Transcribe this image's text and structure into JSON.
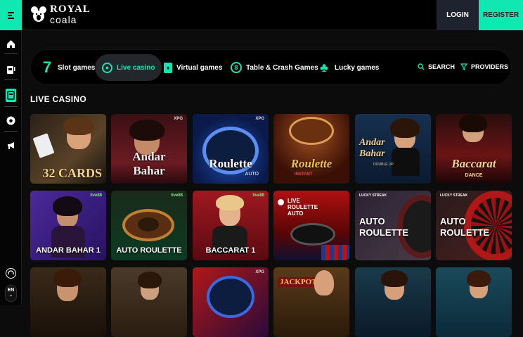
{
  "header": {
    "brand_top": "ROYAL",
    "brand_bottom": "coala",
    "login": "LOGIN",
    "register": "REGISTER"
  },
  "sidebar": {
    "items": [
      "home-icon",
      "slot-machine-icon",
      "live-casino-icon",
      "soccer-ball-icon",
      "megaphone-icon"
    ],
    "support_icon": "headset-icon",
    "language": "EN"
  },
  "nav": {
    "items": [
      {
        "label": "Slot games",
        "icon": "7"
      },
      {
        "label": "Live casino",
        "icon": "live-icon",
        "active": true
      },
      {
        "label": "Virtual games",
        "icon": "card-icon"
      },
      {
        "label": "Table & Crash Games",
        "icon": "8"
      },
      {
        "label": "Lucky games",
        "icon": "club-icon"
      }
    ],
    "search": "SEARCH",
    "providers": "PROVIDERS"
  },
  "section_title": "LIVE CASINO",
  "games": [
    {
      "title": "32 CARDS"
    },
    {
      "title": "Andar Bahar",
      "badge": "XPG"
    },
    {
      "title": "Roulette",
      "badge": "XPG",
      "sub": "AUTO"
    },
    {
      "title": "Roulette",
      "sub": "INSTANT"
    },
    {
      "title": "Andar Bahar",
      "sub": "DOUBLE UP"
    },
    {
      "title": "Baccarat",
      "sub": "DANCE"
    },
    {
      "title": "ANDAR BAHAR 1",
      "badge": "live88"
    },
    {
      "title": "AUTO ROULETTE",
      "badge": "live88"
    },
    {
      "title": "BACCARAT 1",
      "badge": "live88"
    },
    {
      "title": "LIVE ROULETTE AUTO"
    },
    {
      "title": "AUTO ROULETTE",
      "badge": "LUCKY STREAK"
    },
    {
      "title": "AUTO ROULETTE",
      "badge": "LUCKY STREAK"
    },
    {
      "title": ""
    },
    {
      "title": ""
    },
    {
      "title": "",
      "badge": "XPG"
    },
    {
      "title": "JACKPOT"
    },
    {
      "title": ""
    },
    {
      "title": ""
    }
  ],
  "colors": {
    "accent": "#10e7b1",
    "bg": "#0c0c0d",
    "nav_bg": "#000000",
    "login_bg": "#1f2330"
  }
}
